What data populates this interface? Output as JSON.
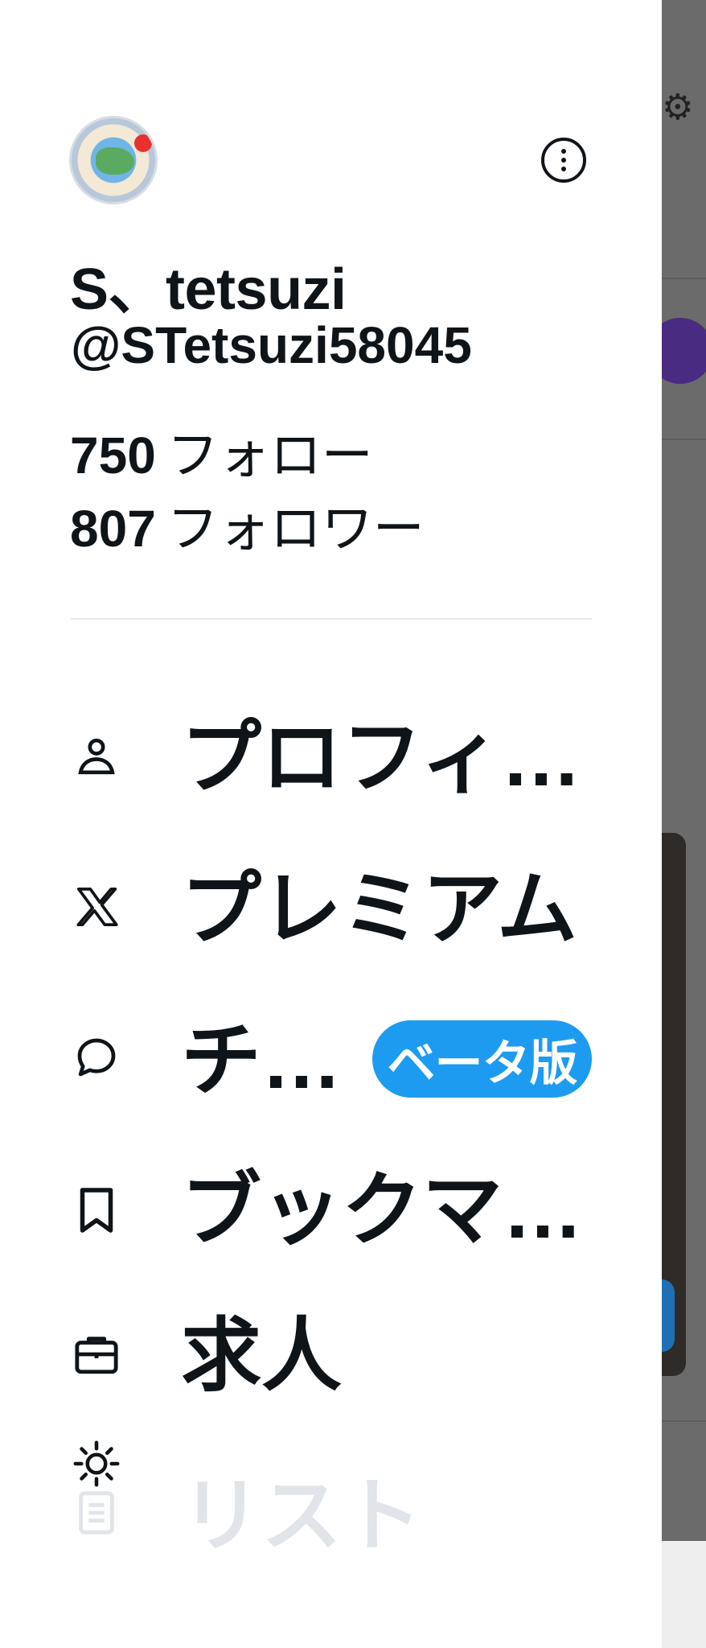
{
  "profile": {
    "display_name": "S、tetsuzi",
    "handle": "@STetsuzi58045",
    "following_count": "750",
    "following_label": "フォロー",
    "followers_count": "807",
    "followers_label": "フォロワー"
  },
  "menu": {
    "items": [
      {
        "id": "profile",
        "label": "プロフィ…",
        "icon": "person-icon"
      },
      {
        "id": "premium",
        "label": "プレミアム",
        "icon": "x-logo-icon"
      },
      {
        "id": "chat",
        "label": "チ…",
        "icon": "chat-bubble-icon",
        "badge": "ベータ版"
      },
      {
        "id": "bookmarks",
        "label": "ブックマ…",
        "icon": "bookmark-icon"
      },
      {
        "id": "jobs",
        "label": "求人",
        "icon": "briefcase-icon"
      },
      {
        "id": "lists",
        "label": "リスト",
        "icon": "list-icon"
      }
    ]
  },
  "floating": {
    "icon": "sun-icon"
  },
  "colors": {
    "text": "#0f1419",
    "accent": "#1d9bf0",
    "overlay": "#6b6b6b",
    "divider": "#e6ecf0"
  }
}
